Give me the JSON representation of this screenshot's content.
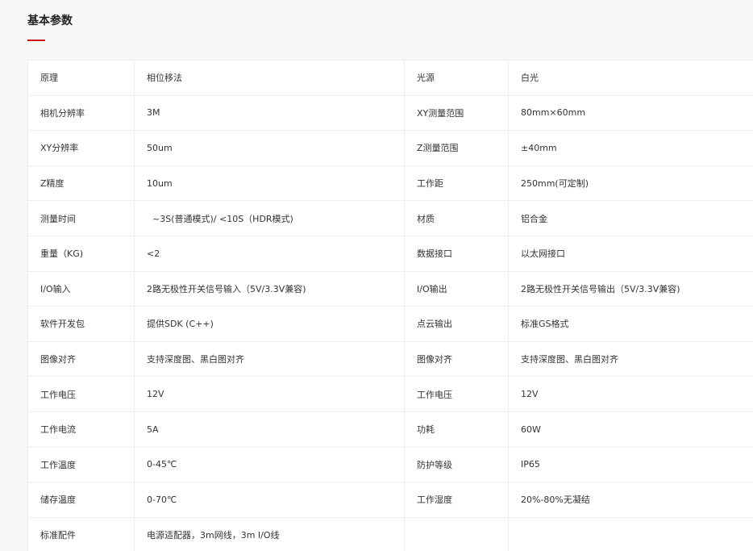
{
  "section": {
    "title": "基本参数"
  },
  "colors": {
    "accent": "#c8161d",
    "border": "#ededed",
    "background": "#f7f7f8"
  },
  "rows": [
    {
      "k1": "原理",
      "v1": "相位移法",
      "k2": "光源",
      "v2": "白光"
    },
    {
      "k1": "相机分辨率",
      "v1": "3M",
      "k2": "XY测量范围",
      "v2": "80mm×60mm"
    },
    {
      "k1": "XY分辨率",
      "v1": "50um",
      "k2": "Z测量范围",
      "v2": "±40mm"
    },
    {
      "k1": "Z精度",
      "v1": "10um",
      "k2": "工作距",
      "v2": "250mm(可定制)"
    },
    {
      "k1": "测量时间",
      "v1": "  ~3S(普通模式)/ <10S（HDR模式)",
      "k2": "材质",
      "v2": "铝合金"
    },
    {
      "k1": "重量（KG)",
      "v1": "<2",
      "k2": "数据接口",
      "v2": "以太网接口"
    },
    {
      "k1": "I/O输入",
      "v1": "2路无极性开关信号输入（5V/3.3V兼容)",
      "k2": "I/O输出",
      "v2": "2路无极性开关信号输出（5V/3.3V兼容)"
    },
    {
      "k1": "软件开发包",
      "v1": "提供SDK (C++)",
      "k2": "点云输出",
      "v2": "标准GS格式"
    },
    {
      "k1": "图像对齐",
      "v1": "支持深度图、黑白图对齐",
      "k2": "图像对齐",
      "v2": "支持深度图、黑白图对齐"
    },
    {
      "k1": "工作电压",
      "v1": "12V",
      "k2": "工作电压",
      "v2": "12V"
    },
    {
      "k1": "工作电流",
      "v1": "5A",
      "k2": "功耗",
      "v2": "60W"
    },
    {
      "k1": "工作温度",
      "v1": "0-45℃",
      "k2": "防护等级",
      "v2": "IP65"
    },
    {
      "k1": "储存温度",
      "v1": "0-70℃",
      "k2": "工作湿度",
      "v2": "20%-80%无凝结"
    },
    {
      "k1": "标准配件",
      "v1": "电源适配器，3m网线，3m I/O线",
      "k2": "",
      "v2": ""
    }
  ]
}
